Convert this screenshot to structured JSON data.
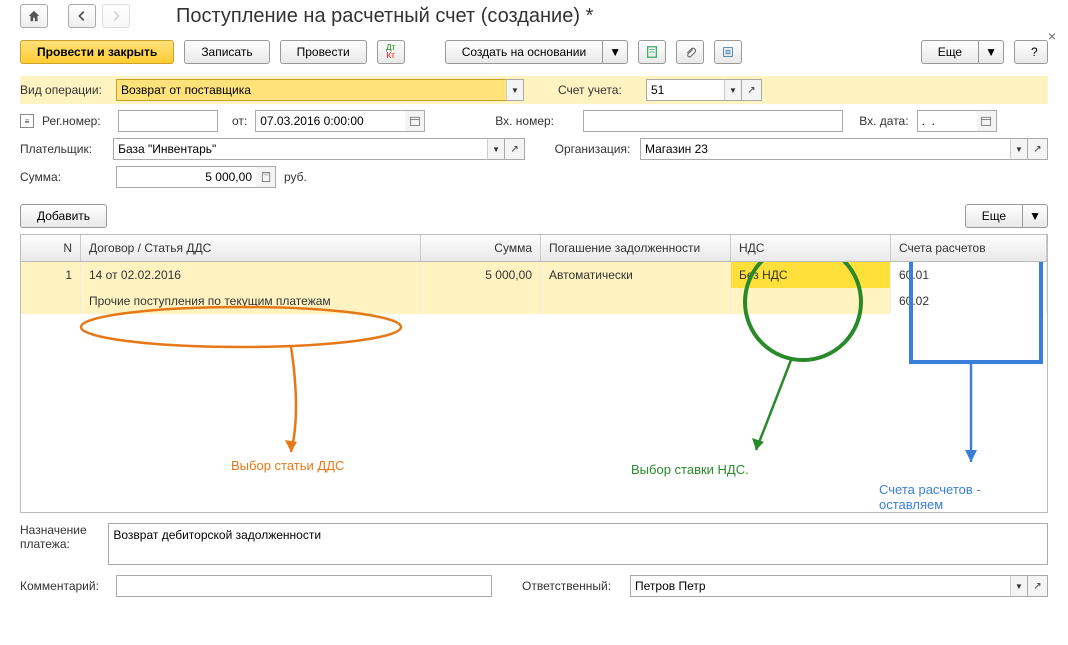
{
  "header": {
    "title": "Поступление на расчетный счет (создание) *"
  },
  "actions": {
    "post_and_close": "Провести и закрыть",
    "save": "Записать",
    "post": "Провести",
    "create_based": "Создать на основании",
    "more": "Еще",
    "help": "?"
  },
  "form": {
    "op_type_label": "Вид операции:",
    "op_type_value": "Возврат от поставщика",
    "account_label": "Счет учета:",
    "account_value": "51",
    "reg_num_label": "Рег.номер:",
    "reg_num_value": "",
    "from_label": "от:",
    "date_value": "07.03.2016 0:00:00",
    "in_num_label": "Вх. номер:",
    "in_num_value": "",
    "in_date_label": "Вх. дата:",
    "in_date_value": ".  .",
    "payer_label": "Плательщик:",
    "payer_value": "База \"Инвентарь\"",
    "org_label": "Организация:",
    "org_value": "Магазин 23",
    "sum_label": "Сумма:",
    "sum_value": "5 000,00",
    "currency": "руб.",
    "add_btn": "Добавить",
    "purpose_label": "Назначение платежа:",
    "purpose_value": "Возврат дебиторской задолженности",
    "comment_label": "Комментарий:",
    "comment_value": "",
    "responsible_label": "Ответственный:",
    "responsible_value": "Петров Петр"
  },
  "grid": {
    "headers": {
      "n": "N",
      "contract": "Договор / Статья ДДС",
      "sum": "Сумма",
      "debt": "Погашение задолженности",
      "vat": "НДС",
      "accounts": "Счета расчетов"
    },
    "row1": {
      "n": "1",
      "contract": "14 от 02.02.2016",
      "sum": "5 000,00",
      "debt": "Автоматически",
      "vat": "Без НДС",
      "acc1": "60.01"
    },
    "row2": {
      "dds": "Прочие поступления по текущим платежам",
      "acc2": "60.02"
    }
  },
  "annotations": {
    "dds": "Выбор статьи ДДС",
    "vat": "Выбор ставки НДС.",
    "accounts": "Счета расчетов - оставляем"
  }
}
